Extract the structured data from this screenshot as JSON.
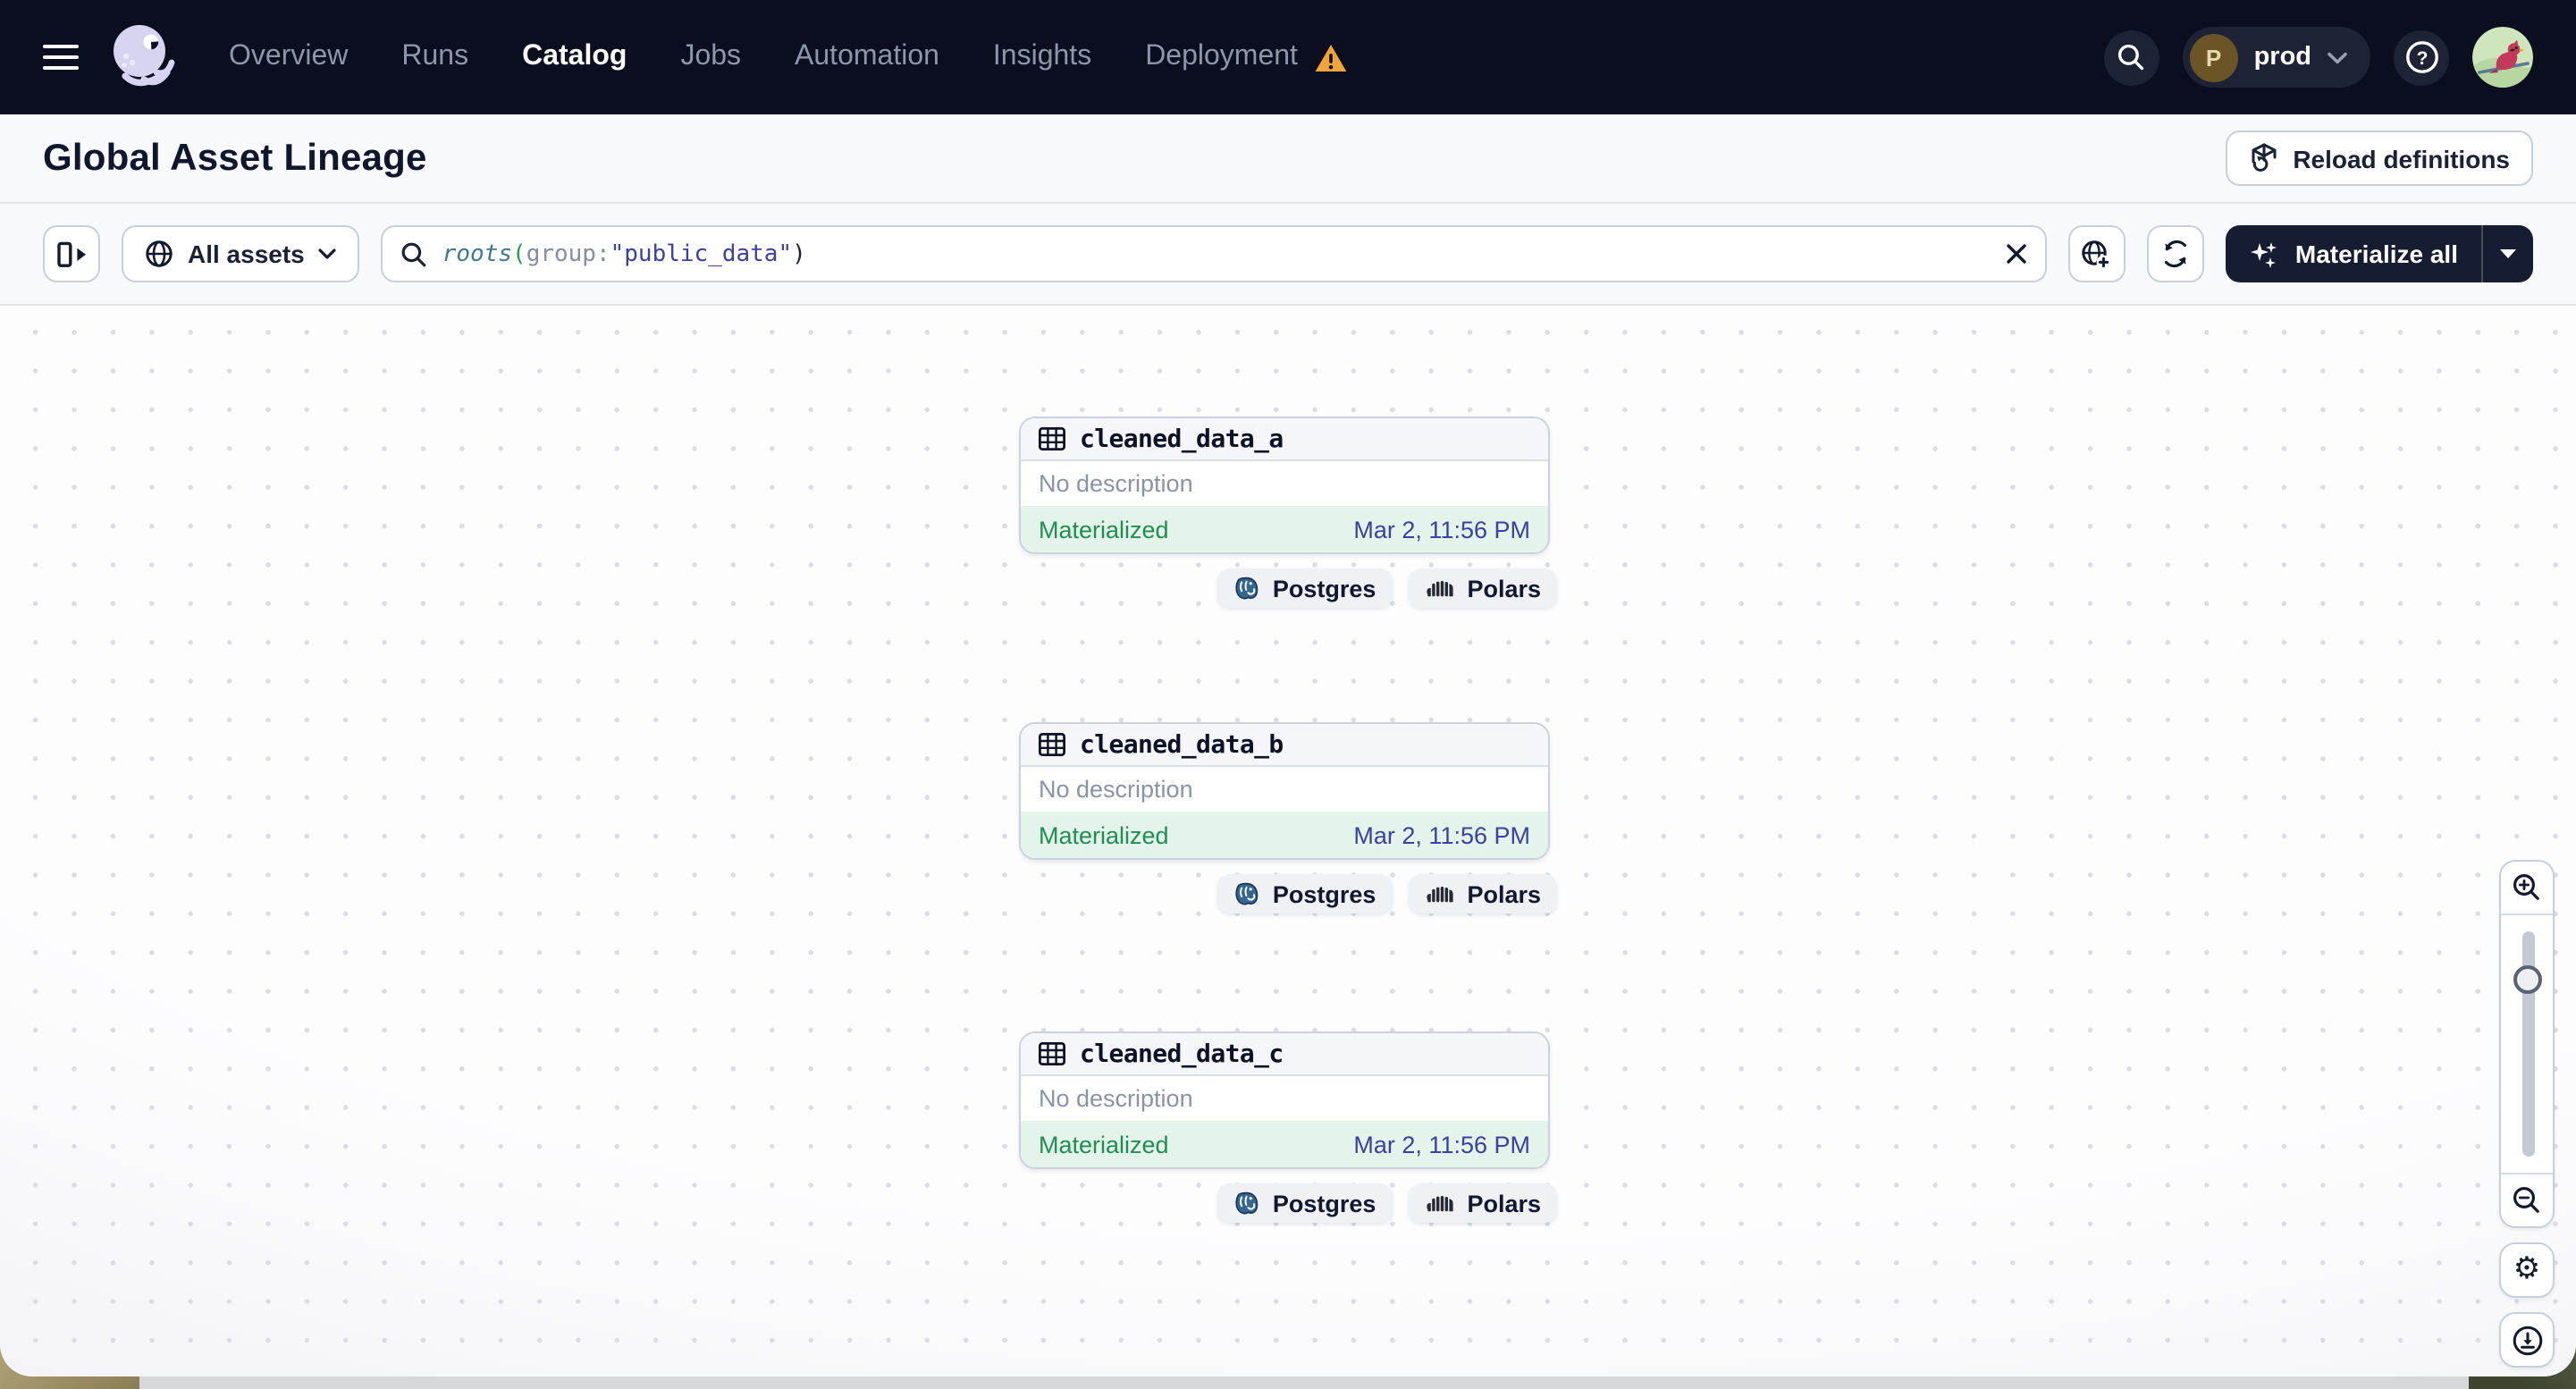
{
  "navbar": {
    "items": [
      {
        "label": "Overview"
      },
      {
        "label": "Runs"
      },
      {
        "label": "Catalog",
        "active": true
      },
      {
        "label": "Jobs"
      },
      {
        "label": "Automation"
      },
      {
        "label": "Insights"
      },
      {
        "label": "Deployment",
        "warning": true
      }
    ],
    "environment": {
      "initial": "P",
      "name": "prod"
    }
  },
  "header": {
    "title": "Global Asset Lineage",
    "reload_button": "Reload definitions"
  },
  "toolbar": {
    "scope_button": "All assets",
    "query": {
      "segments": [
        {
          "text": "roots"
        },
        {
          "text": "("
        },
        {
          "text": "group:"
        },
        {
          "text": "\"public_data\""
        },
        {
          "text": ")"
        }
      ],
      "full_text": "roots(group:\"public_data\")"
    },
    "materialize_button": "Materialize all"
  },
  "graph": {
    "nodes": [
      {
        "name": "cleaned_data_a",
        "description": "No description",
        "status": "Materialized",
        "timestamp": "Mar 2, 11:56 PM",
        "tags": [
          "Postgres",
          "Polars"
        ]
      },
      {
        "name": "cleaned_data_b",
        "description": "No description",
        "status": "Materialized",
        "timestamp": "Mar 2, 11:56 PM",
        "tags": [
          "Postgres",
          "Polars"
        ]
      },
      {
        "name": "cleaned_data_c",
        "description": "No description",
        "status": "Materialized",
        "timestamp": "Mar 2, 11:56 PM",
        "tags": [
          "Postgres",
          "Polars"
        ]
      }
    ]
  },
  "icons": {
    "gear": "⚙"
  },
  "colors": {
    "navbar_bg": "#0A0E1F",
    "accent_dark_button": "#161C31",
    "materialized_green": "#1F8E52",
    "materialized_bg": "#E4F4EA",
    "timestamp_indigo": "#3A40A5",
    "warning_amber": "#EFA43C",
    "query_function_teal": "#3D7A8C",
    "query_string_indigo": "#3A40A5",
    "query_paren_green": "#2D9A4C",
    "postgres_blue": "#336791"
  }
}
